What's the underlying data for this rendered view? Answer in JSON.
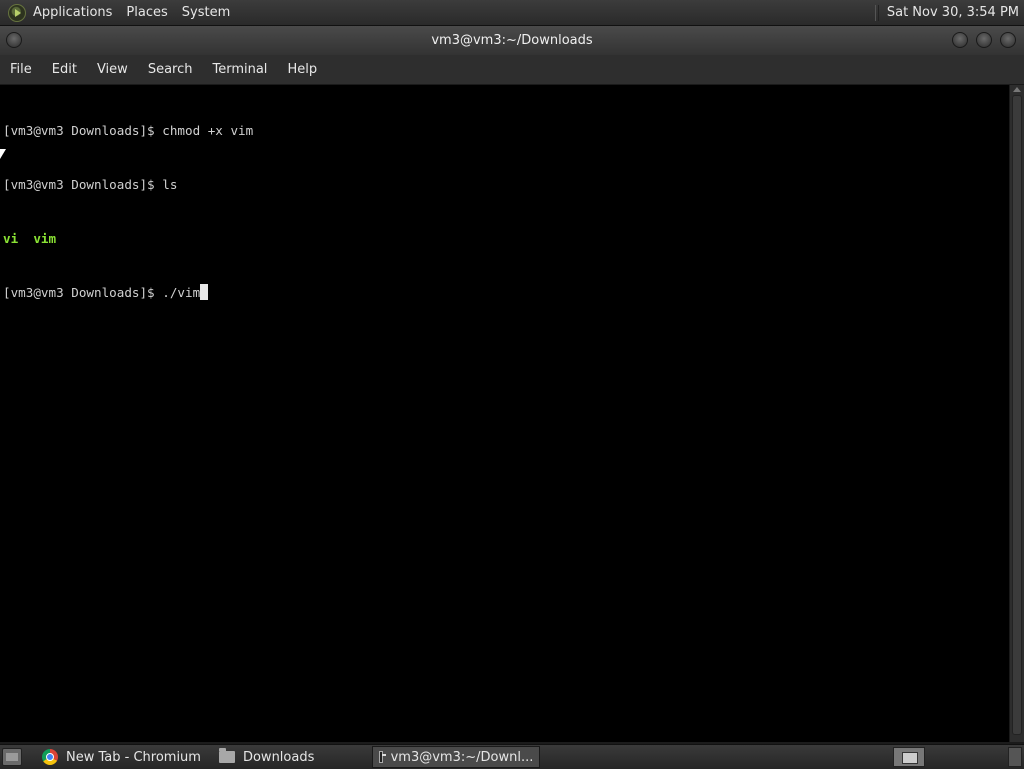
{
  "top_panel": {
    "menus": [
      "Applications",
      "Places",
      "System"
    ],
    "clock": "Sat Nov 30,  3:54 PM"
  },
  "window": {
    "title": "vm3@vm3:~/Downloads"
  },
  "menubar": {
    "items": [
      "File",
      "Edit",
      "View",
      "Search",
      "Terminal",
      "Help"
    ]
  },
  "terminal": {
    "lines": [
      {
        "prompt": "[vm3@vm3 Downloads]$ ",
        "command": "chmod +x vim"
      },
      {
        "prompt": "[vm3@vm3 Downloads]$ ",
        "command": "ls"
      },
      {
        "output": "vi  vim"
      },
      {
        "prompt": "[vm3@vm3 Downloads]$ ",
        "command": "./vim"
      }
    ]
  },
  "taskbar": {
    "tasks": [
      {
        "label": "New Tab - Chromium",
        "icon": "chromium-icon",
        "active": false
      },
      {
        "label": "Downloads",
        "icon": "folder-icon",
        "active": false
      },
      {
        "label": "vm3@vm3:~/Downl...",
        "icon": "terminal-icon",
        "active": true
      }
    ]
  },
  "colors": {
    "terminal_bg": "#000000",
    "terminal_fg": "#d0d0d0",
    "executable_color": "#8ae234",
    "panel_bg": "#2e2e2e"
  }
}
